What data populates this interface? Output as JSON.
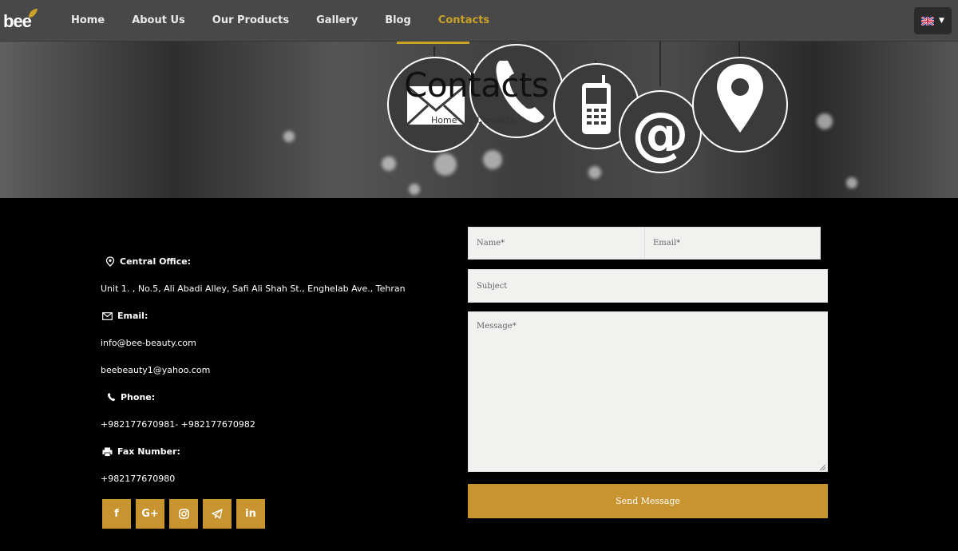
{
  "header": {
    "logo_text": "bee",
    "nav": [
      {
        "label": "Home"
      },
      {
        "label": "About Us"
      },
      {
        "label": "Our Products"
      },
      {
        "label": "Gallery"
      },
      {
        "label": "Blog"
      },
      {
        "label": "Contacts",
        "active": true
      }
    ],
    "language_icon": "uk-flag-icon"
  },
  "hero": {
    "title": "Contacts",
    "breadcrumb": {
      "home": "Home",
      "current": "Contacts"
    }
  },
  "contact_info": {
    "office_label": "Central Office:",
    "office_address": "Unit 1. , No.5, Ali Abadi Alley, Safi Ali Shah St., Enghelab Ave., Tehran",
    "email_label": "Email:",
    "email_1": "info@bee-beauty.com",
    "email_2": "beebeauty1@yahoo.com",
    "phone_label": "Phone:",
    "phone_numbers": "+982177670981- +982177670982",
    "fax_label": "Fax Number:",
    "fax_number": "+982177670980"
  },
  "social": {
    "facebook": "f",
    "google_plus": "G+",
    "instagram_icon": "instagram-icon",
    "telegram_icon": "telegram-icon",
    "linkedin": "in"
  },
  "form": {
    "name_placeholder": "Name*",
    "email_placeholder": "Email*",
    "subject_placeholder": "Subject",
    "message_placeholder": "Message*",
    "send_label": "Send Message"
  },
  "colors": {
    "accent": "#c7942f",
    "active_nav": "#c9a227",
    "header_bg": "#484848",
    "page_bg": "#000000",
    "field_bg": "#f1f1f0"
  }
}
